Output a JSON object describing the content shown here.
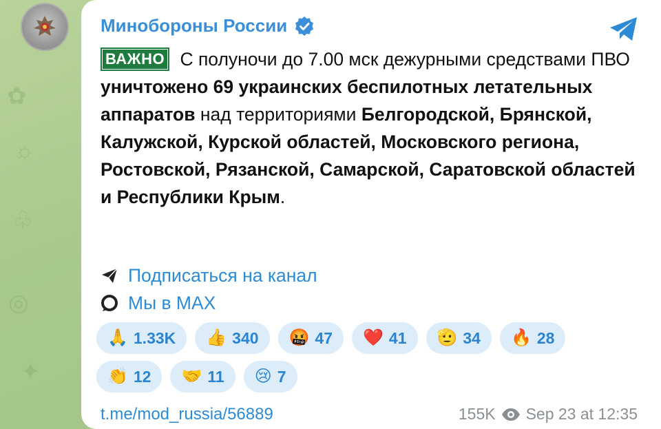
{
  "channel": {
    "name": "Минобороны России",
    "avatar_icon": "mod-emblem-icon",
    "verified_icon": "verified-badge-icon",
    "app_icon": "telegram-plane-icon"
  },
  "post": {
    "badge": "ВАЖНО",
    "segments": [
      {
        "text": " С полуночи до 7.00 мск дежурными средствами ПВО ",
        "bold": false
      },
      {
        "text": "уничтожено 69 украинских беспилотных летательных аппаратов",
        "bold": true
      },
      {
        "text": " над территориями ",
        "bold": false
      },
      {
        "text": "Белгородской, Брянской, Калужской, Курской областей, Московского региона, Ростовской, Рязанской, Самарской, Саратовской областей и Республики Крым",
        "bold": true
      },
      {
        "text": ".",
        "bold": false
      }
    ]
  },
  "links": [
    {
      "icon": "send-arrow-icon",
      "label": "Подписаться на канал"
    },
    {
      "icon": "max-logo-icon",
      "label": "Мы в MAX"
    }
  ],
  "reactions": [
    {
      "emoji": "🙏",
      "count": "1.33K"
    },
    {
      "emoji": "👍",
      "count": "340"
    },
    {
      "emoji": "🤬",
      "count": "47"
    },
    {
      "emoji": "❤️",
      "count": "41"
    },
    {
      "emoji": "🫡",
      "count": "34"
    },
    {
      "emoji": "🔥",
      "count": "28"
    },
    {
      "emoji": "👏",
      "count": "12"
    },
    {
      "emoji": "🤝",
      "count": "11"
    },
    {
      "emoji": "😢",
      "count": "7"
    }
  ],
  "footer": {
    "post_link": "t.me/mod_russia/56889",
    "views": "155K",
    "views_icon": "eye-icon",
    "timestamp": "Sep 23 at 12:35"
  },
  "colors": {
    "accent": "#2d8bd5",
    "badge_bg": "#1f7a3d",
    "reaction_bg": "#dcedf9",
    "wallpaper": "#a9c98c"
  }
}
